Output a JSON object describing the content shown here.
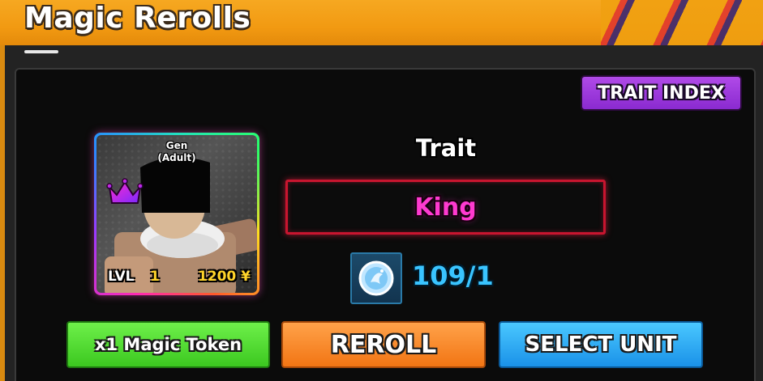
{
  "window": {
    "title": "Magic Rerolls"
  },
  "toolbar": {
    "trait_index_label": "TRAIT INDEX"
  },
  "unit": {
    "name_line1": "Gen",
    "name_line2": "(Adult)",
    "level_label": "LVL",
    "level_value": "1",
    "cost": "1200 ¥",
    "crown_icon": "crown-icon",
    "rarity_color": "#ff3ad0"
  },
  "trait": {
    "heading": "Trait",
    "value": "King",
    "value_color": "#ff3ad0"
  },
  "token": {
    "icon": "magic-token-icon",
    "count": "109/1"
  },
  "actions": {
    "token_cost_label": "x1 Magic Token",
    "reroll_label": "REROLL",
    "select_unit_label": "SELECT UNIT"
  },
  "colors": {
    "header_orange": "#f29a12",
    "reroll_orange": "#f27514",
    "token_green": "#3cc820",
    "select_blue": "#1a92e8",
    "trait_index_purple": "#8a2ad0",
    "trait_border_red": "#c8152f",
    "token_blue_text": "#39c4ff"
  }
}
